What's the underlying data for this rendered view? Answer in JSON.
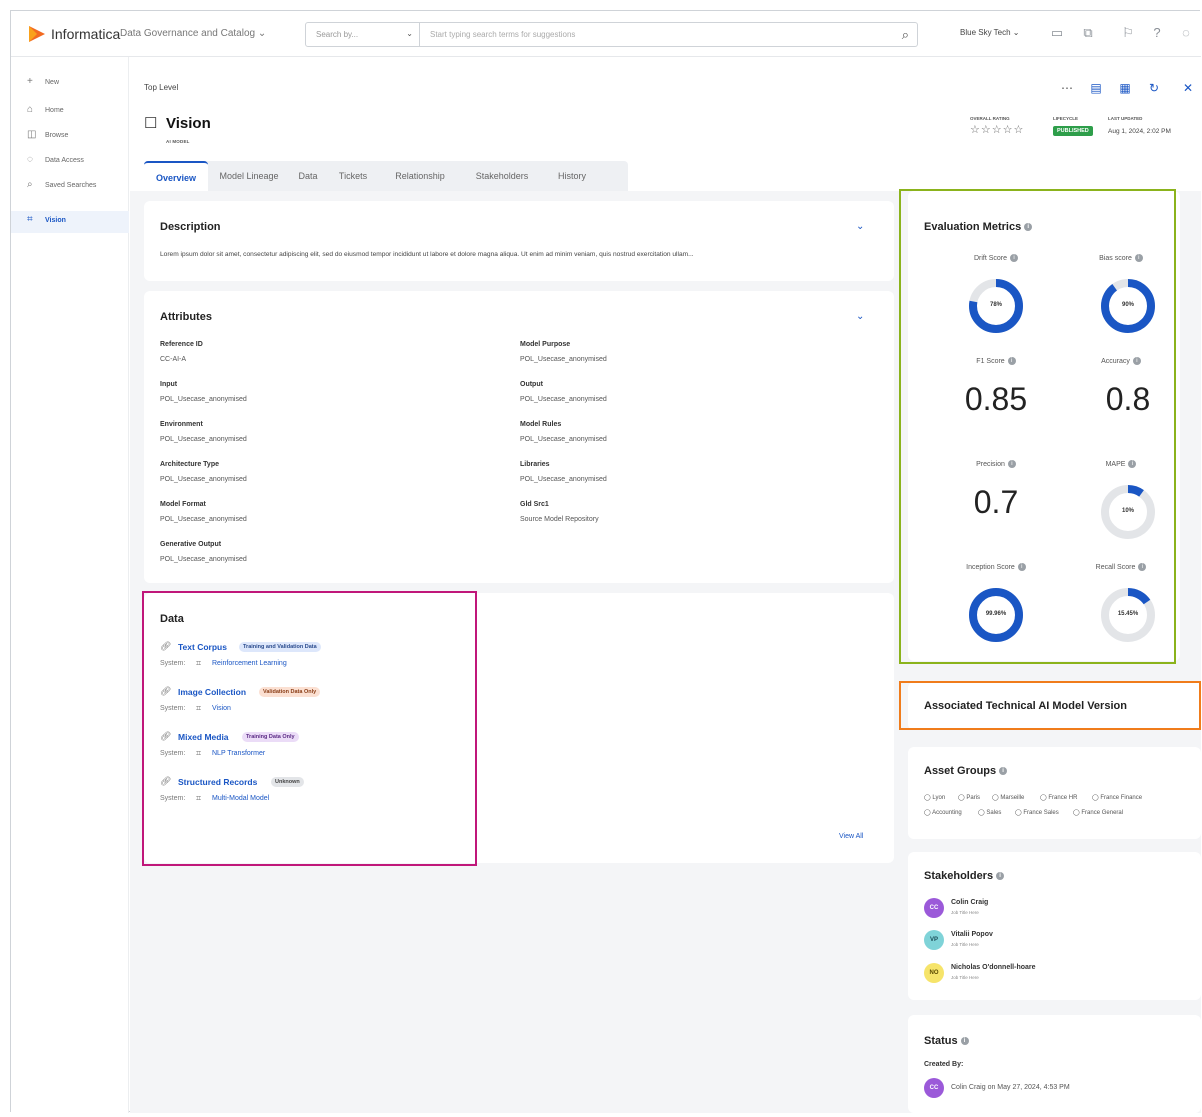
{
  "topbar": {
    "brand": "Informatica",
    "product": "Data Governance and Catalog",
    "search_by": "Search by...",
    "search_placeholder": "Start typing search terms for suggestions",
    "org": "Blue Sky Tech"
  },
  "sidebar": {
    "items": [
      {
        "label": "New",
        "icon": "plus-icon"
      },
      {
        "label": "Home",
        "icon": "home-icon"
      },
      {
        "label": "Browse",
        "icon": "browse-icon"
      },
      {
        "label": "Data Access",
        "icon": "data-access-icon"
      },
      {
        "label": "Saved Searches",
        "icon": "saved-search-icon"
      },
      {
        "label": "Vision",
        "icon": "model-icon"
      }
    ]
  },
  "header": {
    "breadcrumb": "Top Level",
    "title": "Vision",
    "subtitle": "AI MODEL",
    "overall_rating_label": "OVERALL RATING",
    "stars": "☆☆☆☆☆",
    "lifecycle_label": "LIFECYCLE",
    "lifecycle": "PUBLISHED",
    "last_updated_label": "LAST UPDATED",
    "last_updated": "Aug 1, 2024, 2:02 PM"
  },
  "tabs": [
    "Overview",
    "Model Lineage",
    "Data",
    "Tickets",
    "Relationship",
    "Stakeholders",
    "History"
  ],
  "description": {
    "title": "Description",
    "text": "Lorem ipsum dolor sit amet, consectetur adipiscing elit, sed do eiusmod tempor incididunt ut labore et dolore magna aliqua. Ut enim ad minim veniam, quis nostrud exercitation ullam..."
  },
  "attributes": {
    "title": "Attributes",
    "left": [
      {
        "label": "Reference ID",
        "value": "CC-AI-A"
      },
      {
        "label": "Input",
        "value": "POL_Usecase_anonymised"
      },
      {
        "label": "Environment",
        "value": "POL_Usecase_anonymised"
      },
      {
        "label": "Architecture Type",
        "value": "POL_Usecase_anonymised"
      },
      {
        "label": "Model Format",
        "value": "POL_Usecase_anonymised"
      },
      {
        "label": "Generative Output",
        "value": "POL_Usecase_anonymised"
      }
    ],
    "right": [
      {
        "label": "Model Purpose",
        "value": "POL_Usecase_anonymised"
      },
      {
        "label": "Output",
        "value": "POL_Usecase_anonymised"
      },
      {
        "label": "Model Rules",
        "value": "POL_Usecase_anonymised"
      },
      {
        "label": "Libraries",
        "value": "POL_Usecase_anonymised"
      },
      {
        "label": "Gld Src1",
        "value": "Source Model Repository"
      }
    ]
  },
  "data": {
    "title": "Data",
    "system_label": "System:",
    "view_all": "View All",
    "items": [
      {
        "name": "Text Corpus",
        "badge": "Training and Validation Data",
        "badge_bg": "#dde7fb",
        "badge_fg": "#2a4b8d",
        "system": "Reinforcement Learning"
      },
      {
        "name": "Image Collection",
        "badge": "Validation Data Only",
        "badge_bg": "#fbe0d2",
        "badge_fg": "#8a3d16",
        "system": "Vision"
      },
      {
        "name": "Mixed Media",
        "badge": "Training Data Only",
        "badge_bg": "#ebdcf7",
        "badge_fg": "#5b2a84",
        "system": "NLP Transformer"
      },
      {
        "name": "Structured Records",
        "badge": "Unknown",
        "badge_bg": "#e3e5e8",
        "badge_fg": "#444444",
        "system": "Multi-Modal Model"
      }
    ]
  },
  "metrics": {
    "title": "Evaluation Metrics",
    "rings": [
      {
        "label": "Drift Score",
        "value": 0.78,
        "text": "78%"
      },
      {
        "label": "Bias score",
        "value": 0.9,
        "text": "90%"
      },
      {
        "label": "MAPE",
        "value": 0.1,
        "text": "10%"
      },
      {
        "label": "Inception Score",
        "value": 0.9996,
        "text": "99.96%"
      },
      {
        "label": "Recall Score",
        "value": 0.1545,
        "text": "15.45%"
      }
    ],
    "numbers": [
      {
        "label": "F1 Score",
        "value": "0.85"
      },
      {
        "label": "Accuracy",
        "value": "0.8"
      },
      {
        "label": "Precision",
        "value": "0.7"
      }
    ]
  },
  "associated": {
    "title": "Associated Technical AI Model Version"
  },
  "asset_groups": {
    "title": "Asset Groups",
    "row1": [
      "Lyon",
      "Paris",
      "Marseille",
      "France HR",
      "France Finance"
    ],
    "row2": [
      "Accounting",
      "Sales",
      "France Sales",
      "France General"
    ]
  },
  "stakeholders": {
    "title": "Stakeholders",
    "people": [
      {
        "initials": "CC",
        "name": "Colin Craig",
        "job": "Job Title Here",
        "bg": "#9b59d9",
        "fg": "#ffffff"
      },
      {
        "initials": "VP",
        "name": "Vitalii Popov",
        "job": "Job Title Here",
        "bg": "#7fd3d8",
        "fg": "#1a4a55"
      },
      {
        "initials": "NO",
        "name": "Nicholas O'donnell-hoare",
        "job": "Job Title Here",
        "bg": "#f6e46a",
        "fg": "#5a4a00"
      }
    ]
  },
  "status": {
    "title": "Status",
    "created_by_label": "Created By:",
    "initials": "CC",
    "created_by": "Colin Craig on May 27, 2024, 4:53 PM"
  },
  "colors": {
    "accent": "#1a56c4",
    "ring_track": "#e3e5e8"
  }
}
